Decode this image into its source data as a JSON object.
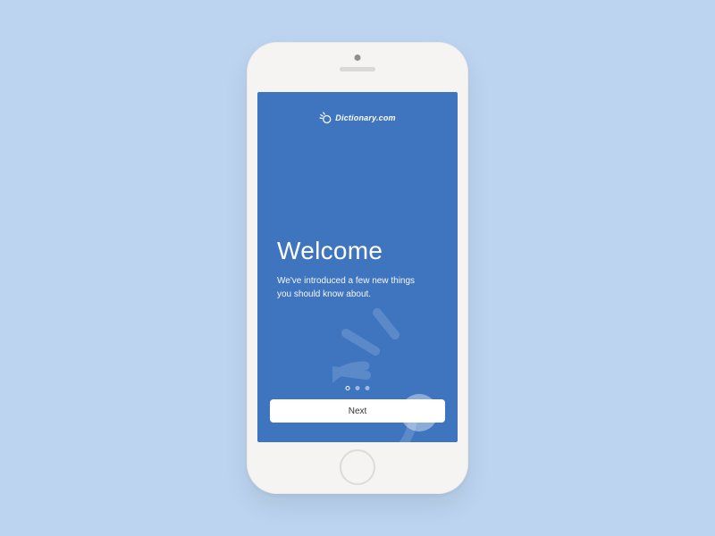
{
  "logo": {
    "text": "Dictionary.com"
  },
  "onboarding": {
    "title": "Welcome",
    "subtitle_line1": "We've introduced a few new things",
    "subtitle_line2": "you should know about."
  },
  "pagination": {
    "current": 1,
    "total": 3
  },
  "cta": {
    "next_label": "Next"
  }
}
